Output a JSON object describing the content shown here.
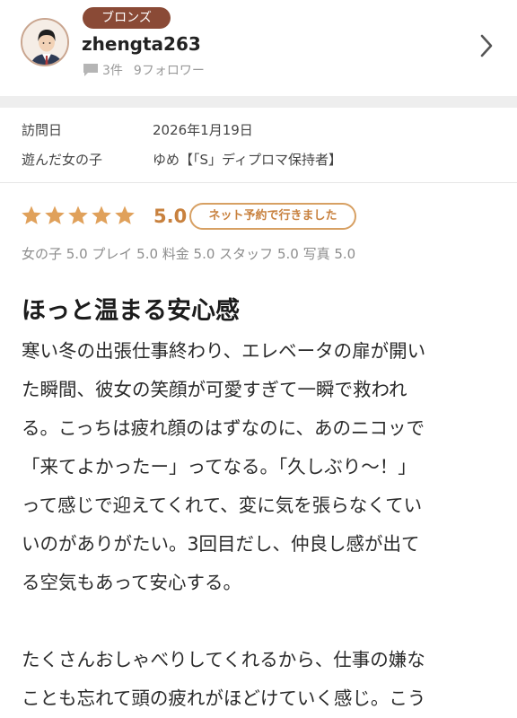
{
  "profile": {
    "rank": "ブロンズ",
    "username": "zhengta263",
    "reviews_count": "3件",
    "followers": "9フォロワー"
  },
  "visit": {
    "date_label": "訪問日",
    "date_value": "2026年1月19日",
    "girl_label": "遊んだ女の子",
    "girl_value": "ゆめ【「S」ディプロマ保持者】"
  },
  "rating": {
    "stars": 5,
    "score": "5.0",
    "badge": "ネット予約で行きました",
    "sub": "女の子 5.0 プレイ 5.0 料金 5.0 スタッフ 5.0 写真 5.0"
  },
  "review": {
    "title": "ほっと温まる安心感",
    "paragraph1": "寒い冬の出張仕事終わり、エレベータの扉が開い\nた瞬間、彼女の笑顔が可愛すぎて一瞬で救われ\nる。こっちは疲れ顔のはずなのに、あのニコッで\n「来てよかったー」ってなる。「久しぶり〜！」\nって感じで迎えてくれて、変に気を張らなくてい\nいのがありがたい。3回目だし、仲良し感が出て\nる空気もあって安心する。",
    "paragraph2": "たくさんおしゃべりしてくれるから、仕事の嫌な\nことも忘れて頭の疲れがほどけていく感じ。こう"
  },
  "colors": {
    "star": "#e0a15b",
    "accent": "#c8813e",
    "badge_bg": "#8a4a36"
  },
  "icons": [
    "avatar",
    "comment-icon",
    "chevron-right-icon",
    "star-icon"
  ]
}
